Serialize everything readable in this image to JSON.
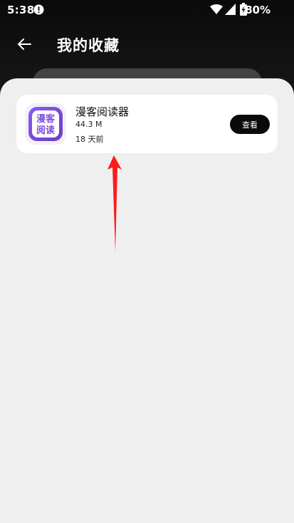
{
  "status_bar": {
    "time": "5:38",
    "battery": "80%",
    "alert_icon": "alert-circle-icon",
    "wifi_icon": "wifi-icon",
    "signal_icon": "signal-icon",
    "battery_icon": "battery-charging-icon"
  },
  "header": {
    "back_icon": "arrow-left-icon",
    "title": "我的收藏"
  },
  "favorites": [
    {
      "icon_text_top": "漫客",
      "icon_text_bottom": "阅读",
      "name": "漫客阅读器",
      "size": "44.3 M",
      "time_ago": "18 天前",
      "action_label": "查看"
    }
  ],
  "colors": {
    "accent_purple": "#7b4fd6",
    "annotation_red": "#ff1a1a",
    "button_black": "#0a0a0a",
    "sheet_bg": "#efefef"
  }
}
